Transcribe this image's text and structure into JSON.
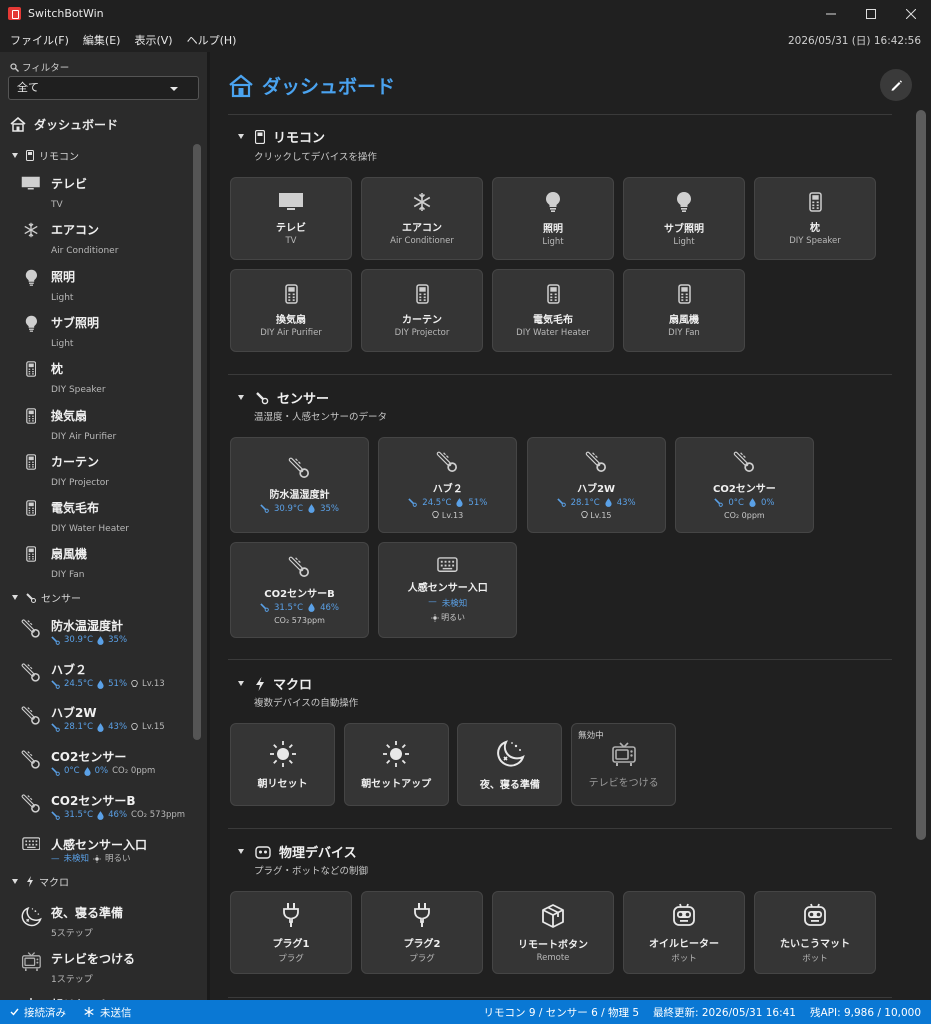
{
  "window": {
    "title": "SwitchBotWin"
  },
  "menu": {
    "items": [
      "ファイル(F)",
      "編集(E)",
      "表示(V)",
      "ヘルプ(H)"
    ],
    "clock": "2026/05/31 (日) 16:42:56"
  },
  "sidebar": {
    "filter_label": "フィルター",
    "filter_value": "全て",
    "dashboard": "ダッシュボード",
    "groups": {
      "remote": "リモコン",
      "sensor": "センサー",
      "macro": "マクロ"
    },
    "remotes": [
      {
        "name": "テレビ",
        "sub": "TV",
        "icon": "tv-icon"
      },
      {
        "name": "エアコン",
        "sub": "Air Conditioner",
        "icon": "snowflake-icon"
      },
      {
        "name": "照明",
        "sub": "Light",
        "icon": "bulb-icon"
      },
      {
        "name": "サブ照明",
        "sub": "Light",
        "icon": "bulb-icon"
      },
      {
        "name": "枕",
        "sub": "DIY Speaker",
        "icon": "remote-icon"
      },
      {
        "name": "換気扇",
        "sub": "DIY Air Purifier",
        "icon": "remote-icon"
      },
      {
        "name": "カーテン",
        "sub": "DIY Projector",
        "icon": "remote-icon"
      },
      {
        "name": "電気毛布",
        "sub": "DIY Water Heater",
        "icon": "remote-icon"
      },
      {
        "name": "扇風機",
        "sub": "DIY Fan",
        "icon": "remote-icon"
      }
    ],
    "sensors": [
      {
        "name": "防水温湿度計",
        "temp": "30.9°C",
        "hum": "35%",
        "extra": ""
      },
      {
        "name": "ハブ２",
        "temp": "24.5°C",
        "hum": "51%",
        "extra": "Lv.13"
      },
      {
        "name": "ハブ2W",
        "temp": "28.1°C",
        "hum": "43%",
        "extra": "Lv.15"
      },
      {
        "name": "CO2センサー",
        "temp": "0°C",
        "hum": "0%",
        "extra": "CO₂ 0ppm"
      },
      {
        "name": "CO2センサーB",
        "temp": "31.5°C",
        "hum": "46%",
        "extra": "CO₂ 573ppm"
      },
      {
        "name": "人感センサー入口",
        "motion": "未検知",
        "bright": "明るい"
      }
    ],
    "macros": [
      {
        "name": "夜、寝る準備",
        "sub": "5ステップ"
      },
      {
        "name": "テレビをつける",
        "sub": "1ステップ"
      },
      {
        "name": "朝リセット",
        "sub": ""
      }
    ]
  },
  "main": {
    "title": "ダッシュボード",
    "remote_section": {
      "title": "リモコン",
      "sub": "クリックしてデバイスを操作"
    },
    "sensor_section": {
      "title": "センサー",
      "sub": "温湿度・人感センサーのデータ"
    },
    "macro_section": {
      "title": "マクロ",
      "sub": "複数デバイスの自動操作"
    },
    "physical_section": {
      "title": "物理デバイス",
      "sub": "プラグ・ボットなどの制御"
    },
    "sensor_cards": [
      {
        "name": "防水温湿度計",
        "temp": "30.9°C",
        "hum": "35%",
        "extra": ""
      },
      {
        "name": "ハブ２",
        "temp": "24.5°C",
        "hum": "51%",
        "extra": "Lv.13"
      },
      {
        "name": "ハブ2W",
        "temp": "28.1°C",
        "hum": "43%",
        "extra": "Lv.15"
      },
      {
        "name": "CO2センサー",
        "temp": "0°C",
        "hum": "0%",
        "extra": "CO₂ 0ppm"
      },
      {
        "name": "CO2センサーB",
        "temp": "31.5°C",
        "hum": "46%",
        "extra": "CO₂ 573ppm"
      },
      {
        "name": "人感センサー入口",
        "motion": "未検知",
        "bright": "明るい"
      }
    ],
    "macro_cards": [
      {
        "name": "朝リセット",
        "icon": "sun-icon"
      },
      {
        "name": "朝セットアップ",
        "icon": "sun-icon"
      },
      {
        "name": "夜、寝る準備",
        "icon": "moon-icon"
      },
      {
        "name": "テレビをつける",
        "icon": "tv-retro-icon",
        "badge": "無効中"
      }
    ],
    "physical_cards": [
      {
        "name": "プラグ1",
        "sub": "プラグ",
        "icon": "plug-icon"
      },
      {
        "name": "プラグ2",
        "sub": "プラグ",
        "icon": "plug-icon"
      },
      {
        "name": "リモートボタン",
        "sub": "Remote",
        "icon": "box-icon"
      },
      {
        "name": "オイルヒーター",
        "sub": "ボット",
        "icon": "bot-icon"
      },
      {
        "name": "たいこうマット",
        "sub": "ボット",
        "icon": "bot-icon"
      }
    ]
  },
  "status": {
    "connected": "接続済み",
    "unsent": "未送信",
    "counts": "リモコン 9 / センサー 6 / 物理 5",
    "last_update": "最終更新: 2026/05/31 16:41",
    "api": "残API: 9,986 / 10,000"
  },
  "colors": {
    "accent": "#4aa3f0",
    "status_bar": "#0a78d4",
    "card": "#353535"
  }
}
